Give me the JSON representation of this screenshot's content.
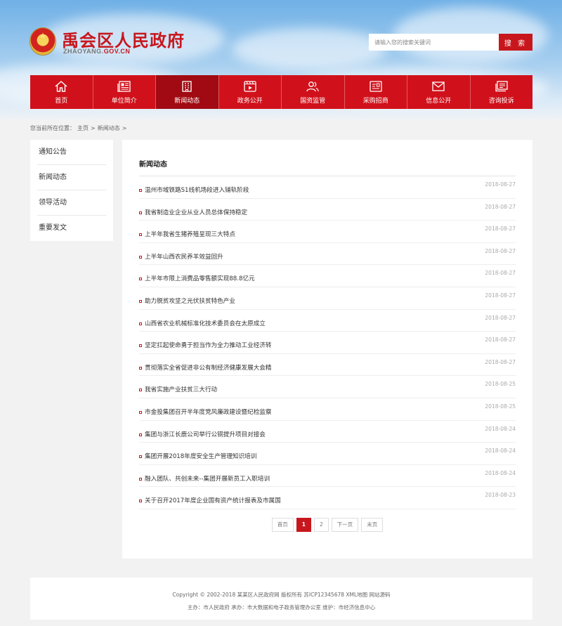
{
  "header": {
    "title": "禹会区人民政府",
    "domain_main": "ZHAOYANG.",
    "domain_accent": "GOV.CN",
    "search_placeholder": "请输入您的搜索关键词",
    "search_button": "搜 索"
  },
  "nav": {
    "items": [
      {
        "label": "首页",
        "icon": "home-icon"
      },
      {
        "label": "单位简介",
        "icon": "newspaper-icon"
      },
      {
        "label": "新闻动态",
        "icon": "building-icon",
        "active": true
      },
      {
        "label": "政务公开",
        "icon": "film-icon"
      },
      {
        "label": "国资监管",
        "icon": "people-icon"
      },
      {
        "label": "采购招商",
        "icon": "id-card-icon"
      },
      {
        "label": "信息公开",
        "icon": "mail-icon"
      },
      {
        "label": "咨询投诉",
        "icon": "stack-icon"
      }
    ]
  },
  "breadcrumb": {
    "prefix": "您当前所在位置：",
    "home": "主页",
    "sep1": ">",
    "current": "新闻动态",
    "sep2": ">"
  },
  "sidebar": {
    "items": [
      "通知公告",
      "新闻动态",
      "领导活动",
      "重要发文"
    ]
  },
  "main": {
    "title": "新闻动态",
    "news": [
      {
        "title": "温州市域铁路S1线机场段进入铺轨阶段",
        "date": "2018-08-27"
      },
      {
        "title": "我省制造业企业从业人员总体保持稳定",
        "date": "2018-08-27"
      },
      {
        "title": "上半年我省生猪养殖呈现三大特点",
        "date": "2018-08-27"
      },
      {
        "title": "上半年山西农民养羊效益回升",
        "date": "2018-08-27"
      },
      {
        "title": "上半年市限上消费品零售额实现88.8亿元",
        "date": "2018-08-27"
      },
      {
        "title": "助力脱贫攻坚之光伏扶贫特色产业",
        "date": "2018-08-27"
      },
      {
        "title": "山西省农业机械标准化技术委员会在太原成立",
        "date": "2018-08-27"
      },
      {
        "title": "坚定扛起使命勇于担当作为全力推动工业经济转",
        "date": "2018-08-27"
      },
      {
        "title": "贯彻落实全省促进非公有制经济健康发展大会精",
        "date": "2018-08-27"
      },
      {
        "title": "我省实施产业扶贫三大行动",
        "date": "2018-08-25"
      },
      {
        "title": "市金投集团召开半年度党风廉政建设暨纪检监察",
        "date": "2018-08-25"
      },
      {
        "title": "集团与浙江长鹿公司举行公铜提升项目对接会",
        "date": "2018-08-24"
      },
      {
        "title": "集团开展2018年度安全生产管理知识培训",
        "date": "2018-08-24"
      },
      {
        "title": "融入团队、共创未来--集团开展新员工入职培训",
        "date": "2018-08-24"
      },
      {
        "title": "关于召开2017年度企业国有资产统计报表及市属国",
        "date": "2018-08-23"
      }
    ]
  },
  "pagination": {
    "first": "首页",
    "pages": [
      "1",
      "2"
    ],
    "current": "1",
    "next": "下一页",
    "last": "末页"
  },
  "footer": {
    "line1": "Copyright © 2002-2018 某某区人民政府网 版权所有 苏ICP12345678 XML地图 网站源码",
    "line2": "主办：市人民政府 承办：市大数据和电子政务管理办公室 维护：市经济信息中心"
  },
  "colors": {
    "brand_red": "#c8161d",
    "nav_red": "#d0111b",
    "nav_active": "#a10a12"
  }
}
